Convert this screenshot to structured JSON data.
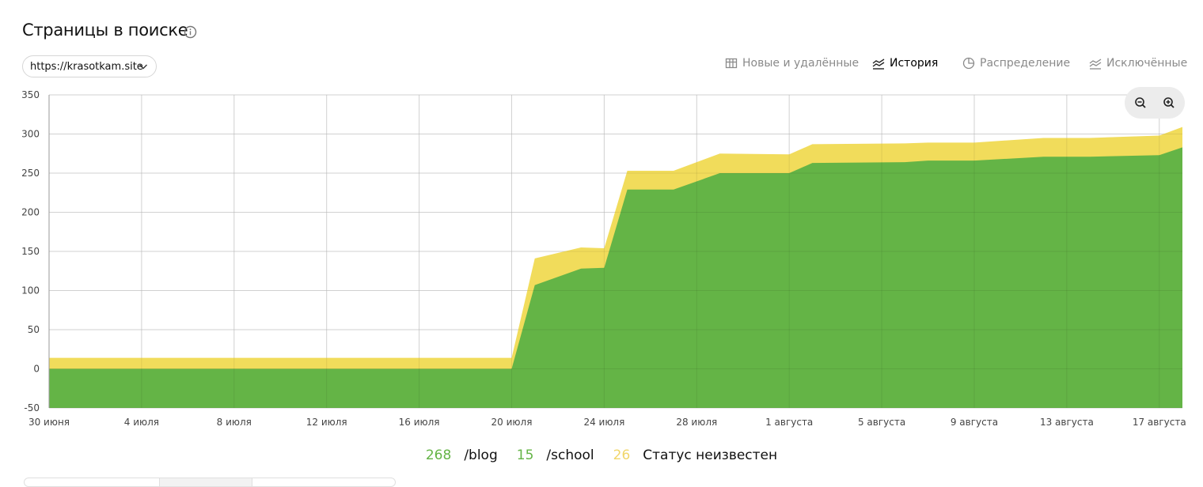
{
  "header": {
    "title": "Страницы в поиске",
    "site_select": "https://krasotkam.site"
  },
  "tabs": [
    {
      "label": "Новые и удалённые",
      "icon": "table-icon",
      "active": false
    },
    {
      "label": "История",
      "icon": "history-chart-icon",
      "active": true
    },
    {
      "label": "Распределение",
      "icon": "pie-chart-icon",
      "active": false
    },
    {
      "label": "Исключённые",
      "icon": "excluded-chart-icon",
      "active": false
    }
  ],
  "zoom": {
    "out_icon": "zoom-out-icon",
    "in_icon": "zoom-in-icon"
  },
  "colors": {
    "blog": "#64b446",
    "school": "#64b446",
    "unknown": "#f1dc5b",
    "legend_unknown_value": "#f1d66a"
  },
  "legend": [
    {
      "value": "268",
      "name": "/blog",
      "color": "#64b446"
    },
    {
      "value": "15",
      "name": "/school",
      "color": "#64b446"
    },
    {
      "value": "26",
      "name": "Статус неизвестен",
      "color": "#f1d66a"
    }
  ],
  "chart_data": {
    "type": "area",
    "stacked": true,
    "x_start": "2024-06-30",
    "x_end": "2024-08-18",
    "x_ticks": [
      "30 июня",
      "4 июля",
      "8 июля",
      "12 июля",
      "16 июля",
      "20 июля",
      "24 июля",
      "28 июля",
      "1 августа",
      "5 августа",
      "9 августа",
      "13 августа",
      "17 августа"
    ],
    "y_ticks": [
      -50,
      0,
      50,
      100,
      150,
      200,
      250,
      300,
      350
    ],
    "ylim": [
      -50,
      350
    ],
    "grid": true,
    "series": [
      {
        "name": "/blog + /school",
        "color": "#64b446",
        "points": [
          [
            "2024-06-30",
            0
          ],
          [
            "2024-07-20",
            0
          ],
          [
            "2024-07-21",
            107
          ],
          [
            "2024-07-23",
            128
          ],
          [
            "2024-07-24",
            129
          ],
          [
            "2024-07-25",
            229
          ],
          [
            "2024-07-27",
            229
          ],
          [
            "2024-07-29",
            250
          ],
          [
            "2024-08-01",
            250
          ],
          [
            "2024-08-02",
            263
          ],
          [
            "2024-08-06",
            264
          ],
          [
            "2024-08-07",
            266
          ],
          [
            "2024-08-09",
            266
          ],
          [
            "2024-08-12",
            271
          ],
          [
            "2024-08-14",
            271
          ],
          [
            "2024-08-17",
            273
          ],
          [
            "2024-08-18",
            283
          ]
        ]
      },
      {
        "name": "Статус неизвестен",
        "color": "#f1dc5b",
        "points": [
          [
            "2024-06-30",
            14
          ],
          [
            "2024-07-20",
            14
          ],
          [
            "2024-07-21",
            141
          ],
          [
            "2024-07-23",
            155
          ],
          [
            "2024-07-24",
            154
          ],
          [
            "2024-07-25",
            253
          ],
          [
            "2024-07-27",
            253
          ],
          [
            "2024-07-29",
            275
          ],
          [
            "2024-08-01",
            274
          ],
          [
            "2024-08-02",
            287
          ],
          [
            "2024-08-06",
            288
          ],
          [
            "2024-08-07",
            289
          ],
          [
            "2024-08-09",
            289
          ],
          [
            "2024-08-12",
            295
          ],
          [
            "2024-08-14",
            295
          ],
          [
            "2024-08-17",
            298
          ],
          [
            "2024-08-18",
            309
          ]
        ]
      }
    ]
  }
}
